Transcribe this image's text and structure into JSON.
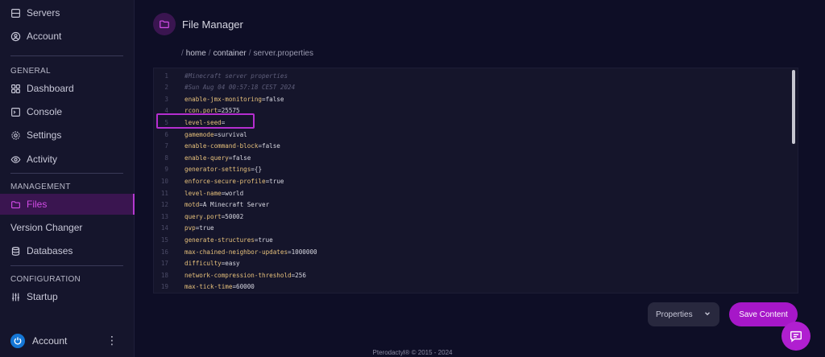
{
  "sidebar": {
    "top_items": [
      {
        "label": "Servers",
        "icon": "server-icon"
      },
      {
        "label": "Account",
        "icon": "user-circle-icon"
      }
    ],
    "sections": [
      {
        "heading": "GENERAL"
      },
      {
        "heading": "MANAGEMENT"
      },
      {
        "heading": "CONFIGURATION"
      }
    ],
    "general": [
      {
        "label": "Dashboard",
        "icon": "grid-icon"
      },
      {
        "label": "Console",
        "icon": "terminal-icon"
      },
      {
        "label": "Settings",
        "icon": "gear-icon"
      },
      {
        "label": "Activity",
        "icon": "eye-icon"
      }
    ],
    "management": [
      {
        "label": "Files",
        "icon": "folder-icon",
        "active": true
      },
      {
        "label": "Version Changer"
      },
      {
        "label": "Databases",
        "icon": "database-icon"
      }
    ],
    "configuration": [
      {
        "label": "Startup",
        "icon": "sliders-icon"
      }
    ],
    "account_bottom": {
      "label": "Account"
    }
  },
  "header": {
    "title": "File Manager"
  },
  "breadcrumb": {
    "sep": "/",
    "parts": [
      "home",
      "container",
      "server.properties"
    ]
  },
  "editor": {
    "lines": [
      {
        "n": "1",
        "text": "#Minecraft server properties",
        "comment": true
      },
      {
        "n": "2",
        "text": "#Sun Aug 04 00:57:18 CEST 2024",
        "comment": true
      },
      {
        "n": "3",
        "key": "enable-jmx-monitoring",
        "val": "false"
      },
      {
        "n": "4",
        "key": "rcon.port",
        "val": "25575"
      },
      {
        "n": "5",
        "key": "level-seed",
        "val": ""
      },
      {
        "n": "6",
        "key": "gamemode",
        "val": "survival"
      },
      {
        "n": "7",
        "key": "enable-command-block",
        "val": "false"
      },
      {
        "n": "8",
        "key": "enable-query",
        "val": "false"
      },
      {
        "n": "9",
        "key": "generator-settings",
        "val": "{}"
      },
      {
        "n": "10",
        "key": "enforce-secure-profile",
        "val": "true"
      },
      {
        "n": "11",
        "key": "level-name",
        "val": "world"
      },
      {
        "n": "12",
        "key": "motd",
        "val": "A Minecraft Server"
      },
      {
        "n": "13",
        "key": "query.port",
        "val": "50002"
      },
      {
        "n": "14",
        "key": "pvp",
        "val": "true"
      },
      {
        "n": "15",
        "key": "generate-structures",
        "val": "true"
      },
      {
        "n": "16",
        "key": "max-chained-neighbor-updates",
        "val": "1000000"
      },
      {
        "n": "17",
        "key": "difficulty",
        "val": "easy"
      },
      {
        "n": "18",
        "key": "network-compression-threshold",
        "val": "256"
      },
      {
        "n": "19",
        "key": "max-tick-time",
        "val": "60000"
      }
    ]
  },
  "controls": {
    "type_select": "Properties",
    "save_label": "Save Content"
  },
  "footer": {
    "text": "Pterodactyl® © 2015 - 2024"
  },
  "colors": {
    "accent": "#a617c8",
    "active_bg": "#3a1550"
  }
}
